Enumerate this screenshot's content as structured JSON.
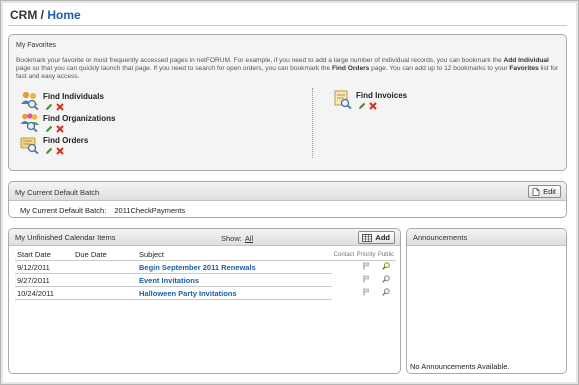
{
  "page": {
    "title_prefix": "CRM /",
    "title_main": "Home"
  },
  "favorites": {
    "label": "My Favorites",
    "desc_1": "Bookmark your favorite or most frequently accessed pages in netFORUM. For example, if you need to add a large number of individual records, you can bookmark the ",
    "desc_b1": "Add Individual",
    "desc_2": " page so that you can quickly launch that page. If you need to search for open orders, you can bookmark the ",
    "desc_b2": "Find Orders",
    "desc_3": " page. You can add up to 12 bookmarks to your ",
    "desc_b3": "Favorites",
    "desc_4": " list for fast and easy access.",
    "items": [
      {
        "label": "Find Individuals",
        "icon": "people-search-icon"
      },
      {
        "label": "Find Organizations",
        "icon": "organization-search-icon"
      },
      {
        "label": "Find Orders",
        "icon": "order-search-icon"
      },
      {
        "label": "Find Invoices",
        "icon": "invoice-search-icon"
      }
    ]
  },
  "batch": {
    "title": "My Current Default Batch",
    "edit_label": "Edit",
    "field_label": "My Current Default Batch:",
    "field_value": "2011CheckPayments"
  },
  "calendar": {
    "title": "My Unfinished Calendar Items",
    "show_label": "Show:",
    "show_value": "All",
    "add_label": "Add",
    "columns": {
      "start": "Start Date",
      "due": "Due Date",
      "subject": "Subject",
      "contact": "Contact",
      "priority": "Priority",
      "public": "Public"
    },
    "rows": [
      {
        "start": "9/12/2011",
        "due": "",
        "subject": "Begin September 2011 Renewals"
      },
      {
        "start": "9/27/2011",
        "due": "",
        "subject": "Event Invitations"
      },
      {
        "start": "10/24/2011",
        "due": "",
        "subject": "Halloween Party Invitations"
      }
    ]
  },
  "announcements": {
    "title": "Announcements",
    "empty_text": "No Announcements Available."
  },
  "colors": {
    "link": "#1a5ea8",
    "delete": "#d8321e",
    "edit": "#4c8a2a"
  }
}
